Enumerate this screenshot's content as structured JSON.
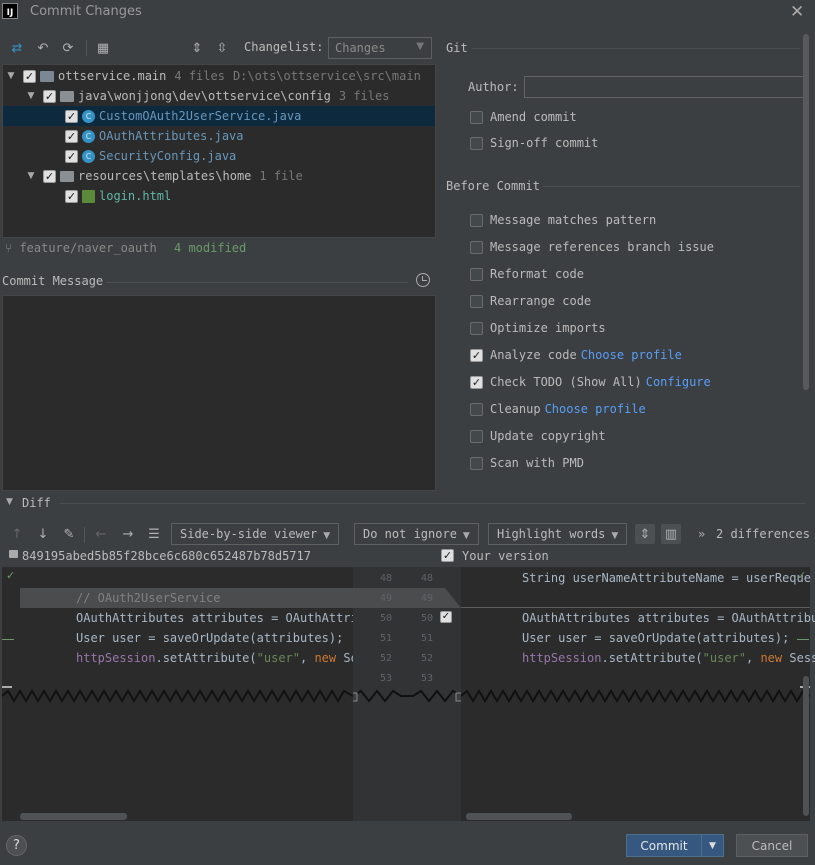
{
  "window": {
    "title": "Commit Changes",
    "logo": "IJ"
  },
  "toolbar": {
    "changelist_label": "Changelist:",
    "changelist_value": "Changes"
  },
  "tree": {
    "root": {
      "name": "ottservice.main",
      "count": "4 files",
      "path": "D:\\ots\\ottservice\\src\\main"
    },
    "config_dir": {
      "name": "java\\wonjjong\\dev\\ottservice\\config",
      "count": "3 files"
    },
    "files": [
      {
        "name": "CustomOAuth2UserService.java"
      },
      {
        "name": "OAuthAttributes.java"
      },
      {
        "name": "SecurityConfig.java"
      }
    ],
    "templates_dir": {
      "name": "resources\\templates\\home",
      "count": "1 file"
    },
    "html_file": {
      "name": "login.html"
    }
  },
  "branch": {
    "name": "feature/naver_oauth",
    "modified": "4 modified"
  },
  "commit_message": {
    "label": "Commit Message",
    "value": ""
  },
  "git": {
    "section": "Git",
    "author_label": "Author:",
    "author_value": "",
    "amend": "Amend commit",
    "signoff": "Sign-off commit"
  },
  "before_commit": {
    "section": "Before Commit",
    "options": [
      {
        "label": "Message matches pattern",
        "checked": false
      },
      {
        "label": "Message references branch issue",
        "checked": false
      },
      {
        "label": "Reformat code",
        "checked": false
      },
      {
        "label": "Rearrange code",
        "checked": false
      },
      {
        "label": "Optimize imports",
        "checked": false
      },
      {
        "label": "Analyze code",
        "link": "Choose profile",
        "checked": true
      },
      {
        "label": "Check TODO (Show All)",
        "link": "Configure",
        "checked": true
      },
      {
        "label": "Cleanup",
        "link": "Choose profile",
        "checked": false
      },
      {
        "label": "Update copyright",
        "checked": false
      },
      {
        "label": "Scan with PMD",
        "checked": false
      }
    ]
  },
  "diff": {
    "label": "Diff",
    "viewer": "Side-by-side viewer",
    "ignore": "Do not ignore",
    "highlight": "Highlight words",
    "differences": "2 differences",
    "hash": "849195abed5b85f28bce6c680c652487b78d5717",
    "your_version": "Your version",
    "left_lines": {
      "comment": "// OAuth2UserService",
      "l50_a": "OAuthAttributes attributes = OAuthAttri",
      "l51": "User user = saveOrUpdate(attributes);",
      "l52_a": "httpSession",
      "l52_b": ".setAttribute(",
      "l52_c": "\"user\"",
      "l52_d": ", ",
      "l52_e": "new",
      "l52_f": " Se"
    },
    "right_lines": {
      "l48": "String userNameAttributeName = userReque",
      "l50_a": "OAuthAttributes attributes = OAuthAttribu",
      "l51": "User user = saveOrUpdate(attributes);",
      "l52_a": "httpSession",
      "l52_b": ".setAttribute(",
      "l52_c": "\"user\"",
      "l52_d": ", ",
      "l52_e": "new",
      "l52_f": " Sessi"
    },
    "line_numbers": {
      "left": [
        "48",
        "49",
        "50",
        "51",
        "52",
        "53"
      ],
      "right": [
        "48",
        "49",
        "50",
        "51",
        "52",
        "53"
      ]
    }
  },
  "footer": {
    "help": "?",
    "commit": "Commit",
    "cancel": "Cancel"
  }
}
